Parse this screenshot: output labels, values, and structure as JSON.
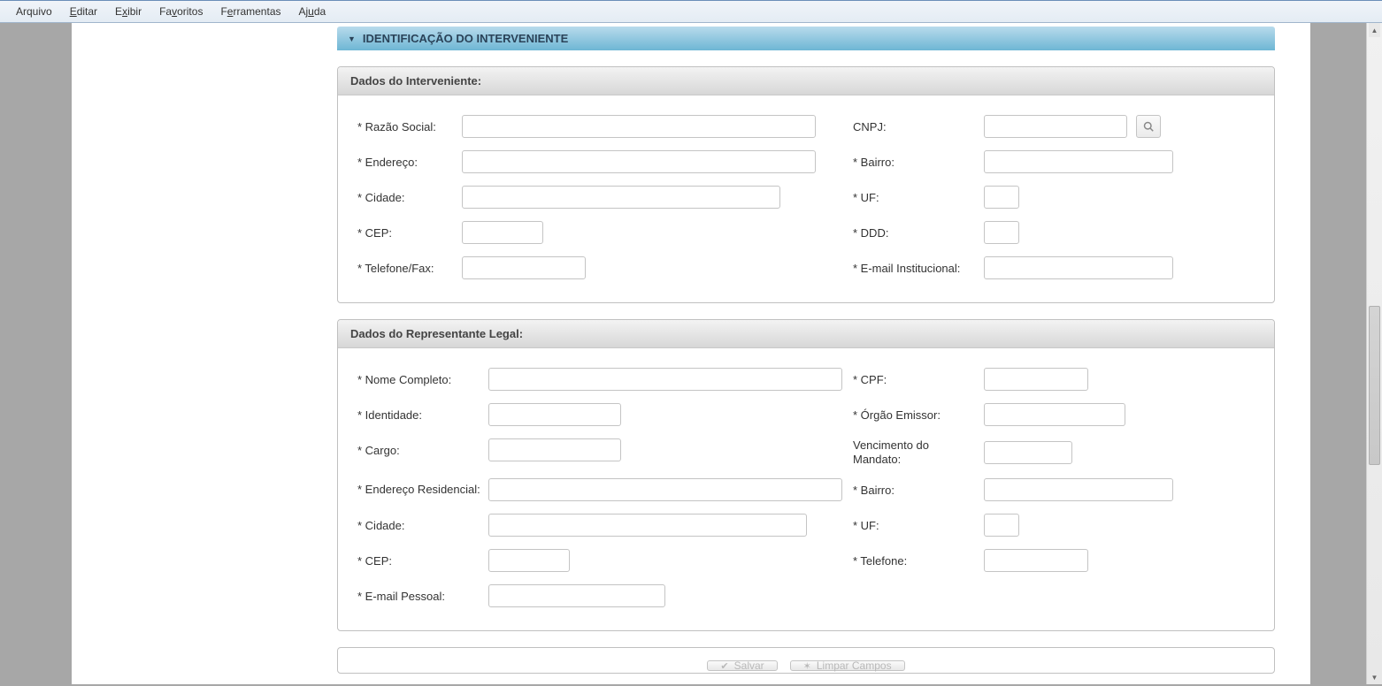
{
  "menu": {
    "arquivo": "Arquivo",
    "editar": "Editar",
    "exibir": "Exibir",
    "favoritos": "Favoritos",
    "ferramentas": "Ferramentas",
    "ajuda": "Ajuda"
  },
  "section": {
    "title": "IDENTIFICAÇÃO DO INTERVENIENTE"
  },
  "interveniente": {
    "panel_title": "Dados do Interveniente:",
    "labels": {
      "razao_social": "* Razão Social:",
      "cnpj": "CNPJ:",
      "endereco": "* Endereço:",
      "bairro": "* Bairro:",
      "cidade": "* Cidade:",
      "uf": "* UF:",
      "cep": "* CEP:",
      "ddd": "* DDD:",
      "telefone_fax": "* Telefone/Fax:",
      "email_institucional": "* E-mail Institucional:"
    },
    "values": {
      "razao_social": "",
      "cnpj": "",
      "endereco": "",
      "bairro": "",
      "cidade": "",
      "uf": "",
      "cep": "",
      "ddd": "",
      "telefone_fax": "",
      "email_institucional": ""
    }
  },
  "representante": {
    "panel_title": "Dados do Representante Legal:",
    "labels": {
      "nome_completo": "* Nome Completo:",
      "cpf": "* CPF:",
      "identidade": "* Identidade:",
      "orgao_emissor": "* Órgão Emissor:",
      "cargo": "* Cargo:",
      "vencimento_mandato": "Vencimento do Mandato:",
      "endereco_residencial": "* Endereço Residencial:",
      "bairro": "* Bairro:",
      "cidade": "* Cidade:",
      "uf": "* UF:",
      "cep": "* CEP:",
      "telefone": "* Telefone:",
      "email_pessoal": "* E-mail Pessoal:"
    },
    "values": {
      "nome_completo": "",
      "cpf": "",
      "identidade": "",
      "orgao_emissor": "",
      "cargo": "",
      "vencimento_mandato": "",
      "endereco_residencial": "",
      "bairro": "",
      "cidade": "",
      "uf": "",
      "cep": "",
      "telefone": "",
      "email_pessoal": ""
    }
  },
  "actions": {
    "salvar": "Salvar",
    "limpar": "Limpar Campos"
  }
}
